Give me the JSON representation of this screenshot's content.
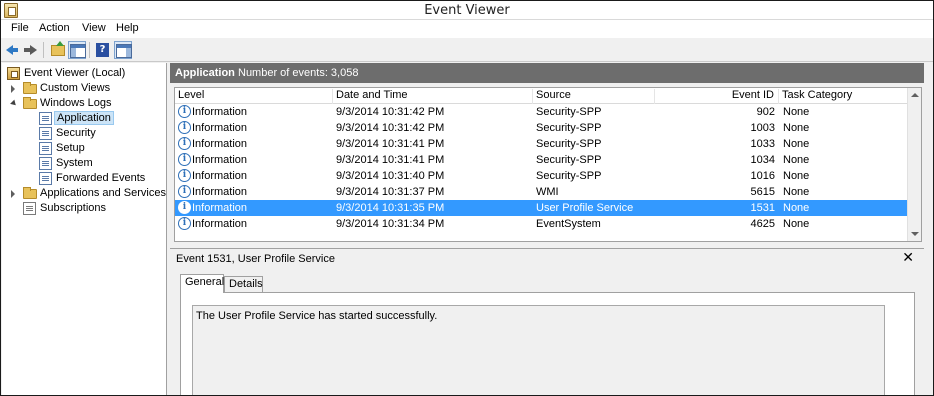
{
  "window": {
    "title": "Event Viewer"
  },
  "menu": [
    {
      "label": "File"
    },
    {
      "label": "Action"
    },
    {
      "label": "View"
    },
    {
      "label": "Help"
    }
  ],
  "toolbar": {
    "buttons": [
      "back-arrow",
      "forward-arrow",
      "up-folder",
      "show-hide-console-tree",
      "help",
      "show-hide-action-pane"
    ]
  },
  "tree": {
    "items": [
      {
        "label": "Event Viewer (Local)",
        "icon": "event-viewer-icon",
        "expander": "none"
      },
      {
        "label": "Custom Views",
        "icon": "folder-icon",
        "expander": "collapsed"
      },
      {
        "label": "Windows Logs",
        "icon": "folder-icon",
        "expander": "expanded"
      },
      {
        "label": "Application",
        "icon": "log-icon",
        "expander": "none",
        "selected": true
      },
      {
        "label": "Security",
        "icon": "log-icon",
        "expander": "none"
      },
      {
        "label": "Setup",
        "icon": "log-icon",
        "expander": "none"
      },
      {
        "label": "System",
        "icon": "log-icon",
        "expander": "none"
      },
      {
        "label": "Forwarded Events",
        "icon": "log-icon",
        "expander": "none"
      },
      {
        "label": "Applications and Services Lo",
        "icon": "folder-icon",
        "expander": "collapsed"
      },
      {
        "label": "Subscriptions",
        "icon": "subscriptions-icon",
        "expander": "none"
      }
    ]
  },
  "main": {
    "title": "Application",
    "count_text": "Number of events: 3,058",
    "columns": [
      "Level",
      "Date and Time",
      "Source",
      "Event ID",
      "Task Category"
    ],
    "rows": [
      {
        "level": "Information",
        "datetime": "9/3/2014 10:31:42 PM",
        "source": "Security-SPP",
        "event_id": "902",
        "category": "None"
      },
      {
        "level": "Information",
        "datetime": "9/3/2014 10:31:42 PM",
        "source": "Security-SPP",
        "event_id": "1003",
        "category": "None"
      },
      {
        "level": "Information",
        "datetime": "9/3/2014 10:31:41 PM",
        "source": "Security-SPP",
        "event_id": "1033",
        "category": "None"
      },
      {
        "level": "Information",
        "datetime": "9/3/2014 10:31:41 PM",
        "source": "Security-SPP",
        "event_id": "1034",
        "category": "None"
      },
      {
        "level": "Information",
        "datetime": "9/3/2014 10:31:40 PM",
        "source": "Security-SPP",
        "event_id": "1016",
        "category": "None"
      },
      {
        "level": "Information",
        "datetime": "9/3/2014 10:31:37 PM",
        "source": "WMI",
        "event_id": "5615",
        "category": "None"
      },
      {
        "level": "Information",
        "datetime": "9/3/2014 10:31:35 PM",
        "source": "User Profile Service",
        "event_id": "1531",
        "category": "None",
        "selected": true
      },
      {
        "level": "Information",
        "datetime": "9/3/2014 10:31:34 PM",
        "source": "EventSystem",
        "event_id": "4625",
        "category": "None"
      }
    ]
  },
  "details": {
    "title": "Event 1531, User Profile Service",
    "tabs": [
      {
        "label": "General",
        "active": true
      },
      {
        "label": "Details",
        "active": false
      }
    ],
    "description": "The User Profile Service has started successfully."
  },
  "colors": {
    "selection": "#3399ff",
    "header_bar": "#6d6d6d",
    "tree_selection": "#cce4f7"
  }
}
